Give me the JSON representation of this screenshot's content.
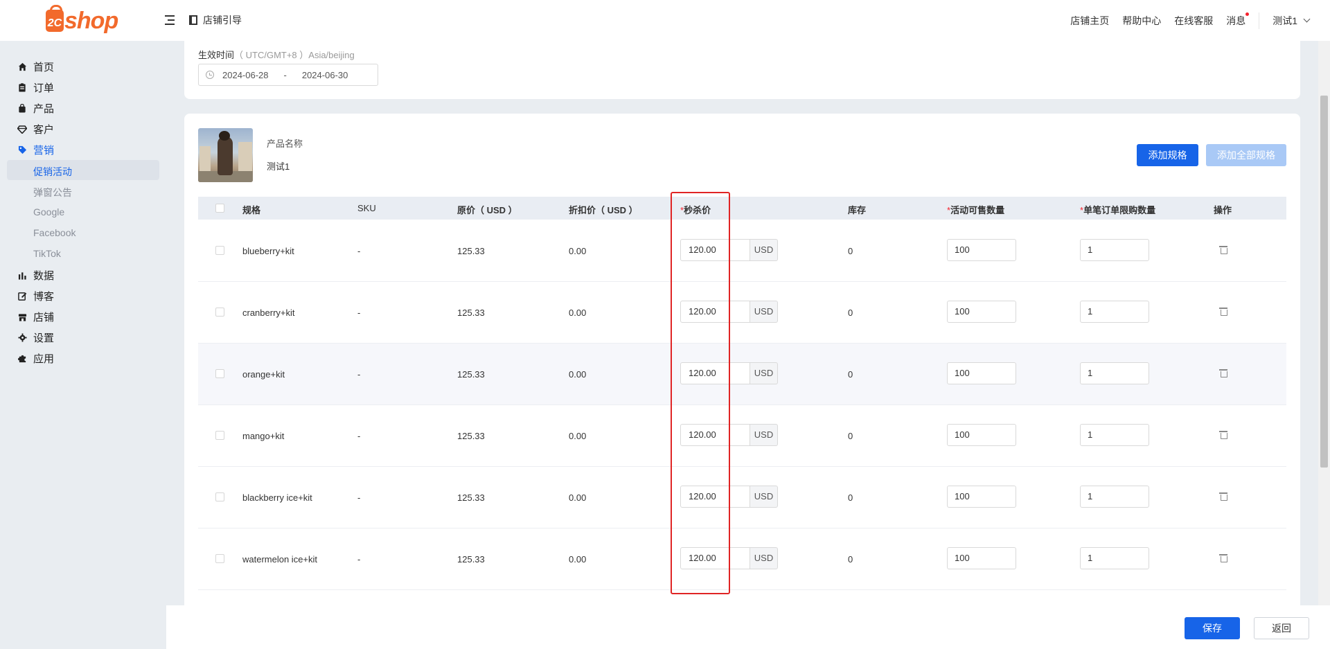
{
  "header": {
    "logo_number": "2C",
    "logo_word": "shop",
    "guide_label": "店铺引导",
    "links": [
      "店铺主页",
      "帮助中心",
      "在线客服"
    ],
    "messages_label": "消息",
    "user_label": "测试1"
  },
  "sidebar": {
    "items": [
      {
        "label": "首页",
        "icon": "home-icon"
      },
      {
        "label": "订单",
        "icon": "order-icon"
      },
      {
        "label": "产品",
        "icon": "product-icon"
      },
      {
        "label": "客户",
        "icon": "customer-icon"
      },
      {
        "label": "营销",
        "icon": "tag-icon"
      },
      {
        "label": "数据",
        "icon": "bar-chart-icon"
      },
      {
        "label": "博客",
        "icon": "edit-icon"
      },
      {
        "label": "店铺",
        "icon": "store-icon"
      },
      {
        "label": "设置",
        "icon": "gear-icon"
      },
      {
        "label": "应用",
        "icon": "puzzle-icon"
      }
    ],
    "sub_items": [
      "促销活动",
      "弹窗公告",
      "Google",
      "Facebook",
      "TikTok"
    ],
    "active_item": "营销",
    "active_sub": "促销活动"
  },
  "effective_time": {
    "label": "生效时间",
    "timezone": "（ UTC/GMT+8 ）Asia/beijing",
    "start": "2024-06-28",
    "separator": "-",
    "end": "2024-06-30"
  },
  "product": {
    "name_label": "产品名称",
    "name": "测试1",
    "add_spec_button": "添加规格",
    "add_all_spec_button": "添加全部规格"
  },
  "table": {
    "headers": {
      "spec": "规格",
      "sku": "SKU",
      "original_price": "原价（ USD ）",
      "discount_price": "折扣价（ USD ）",
      "flash_price": "秒杀价",
      "stock": "库存",
      "activity_qty": "活动可售数量",
      "order_limit": "单笔订单限购数量",
      "action": "操作"
    },
    "required_mark": "*",
    "currency": "USD",
    "rows": [
      {
        "spec": "blueberry+kit",
        "sku": "-",
        "original": "125.33",
        "discount": "0.00",
        "flash": "120.00",
        "stock": "0",
        "qty": "100",
        "limit": "1"
      },
      {
        "spec": "cranberry+kit",
        "sku": "-",
        "original": "125.33",
        "discount": "0.00",
        "flash": "120.00",
        "stock": "0",
        "qty": "100",
        "limit": "1"
      },
      {
        "spec": "orange+kit",
        "sku": "-",
        "original": "125.33",
        "discount": "0.00",
        "flash": "120.00",
        "stock": "0",
        "qty": "100",
        "limit": "1"
      },
      {
        "spec": "mango+kit",
        "sku": "-",
        "original": "125.33",
        "discount": "0.00",
        "flash": "120.00",
        "stock": "0",
        "qty": "100",
        "limit": "1"
      },
      {
        "spec": "blackberry ice+kit",
        "sku": "-",
        "original": "125.33",
        "discount": "0.00",
        "flash": "120.00",
        "stock": "0",
        "qty": "100",
        "limit": "1"
      },
      {
        "spec": "watermelon ice+kit",
        "sku": "-",
        "original": "125.33",
        "discount": "0.00",
        "flash": "120.00",
        "stock": "0",
        "qty": "100",
        "limit": "1"
      }
    ]
  },
  "footer": {
    "save_button": "保存",
    "back_button": "返回"
  },
  "colors": {
    "brand": "#f26a2c",
    "primary": "#1764e8",
    "highlight": "#e02424"
  }
}
